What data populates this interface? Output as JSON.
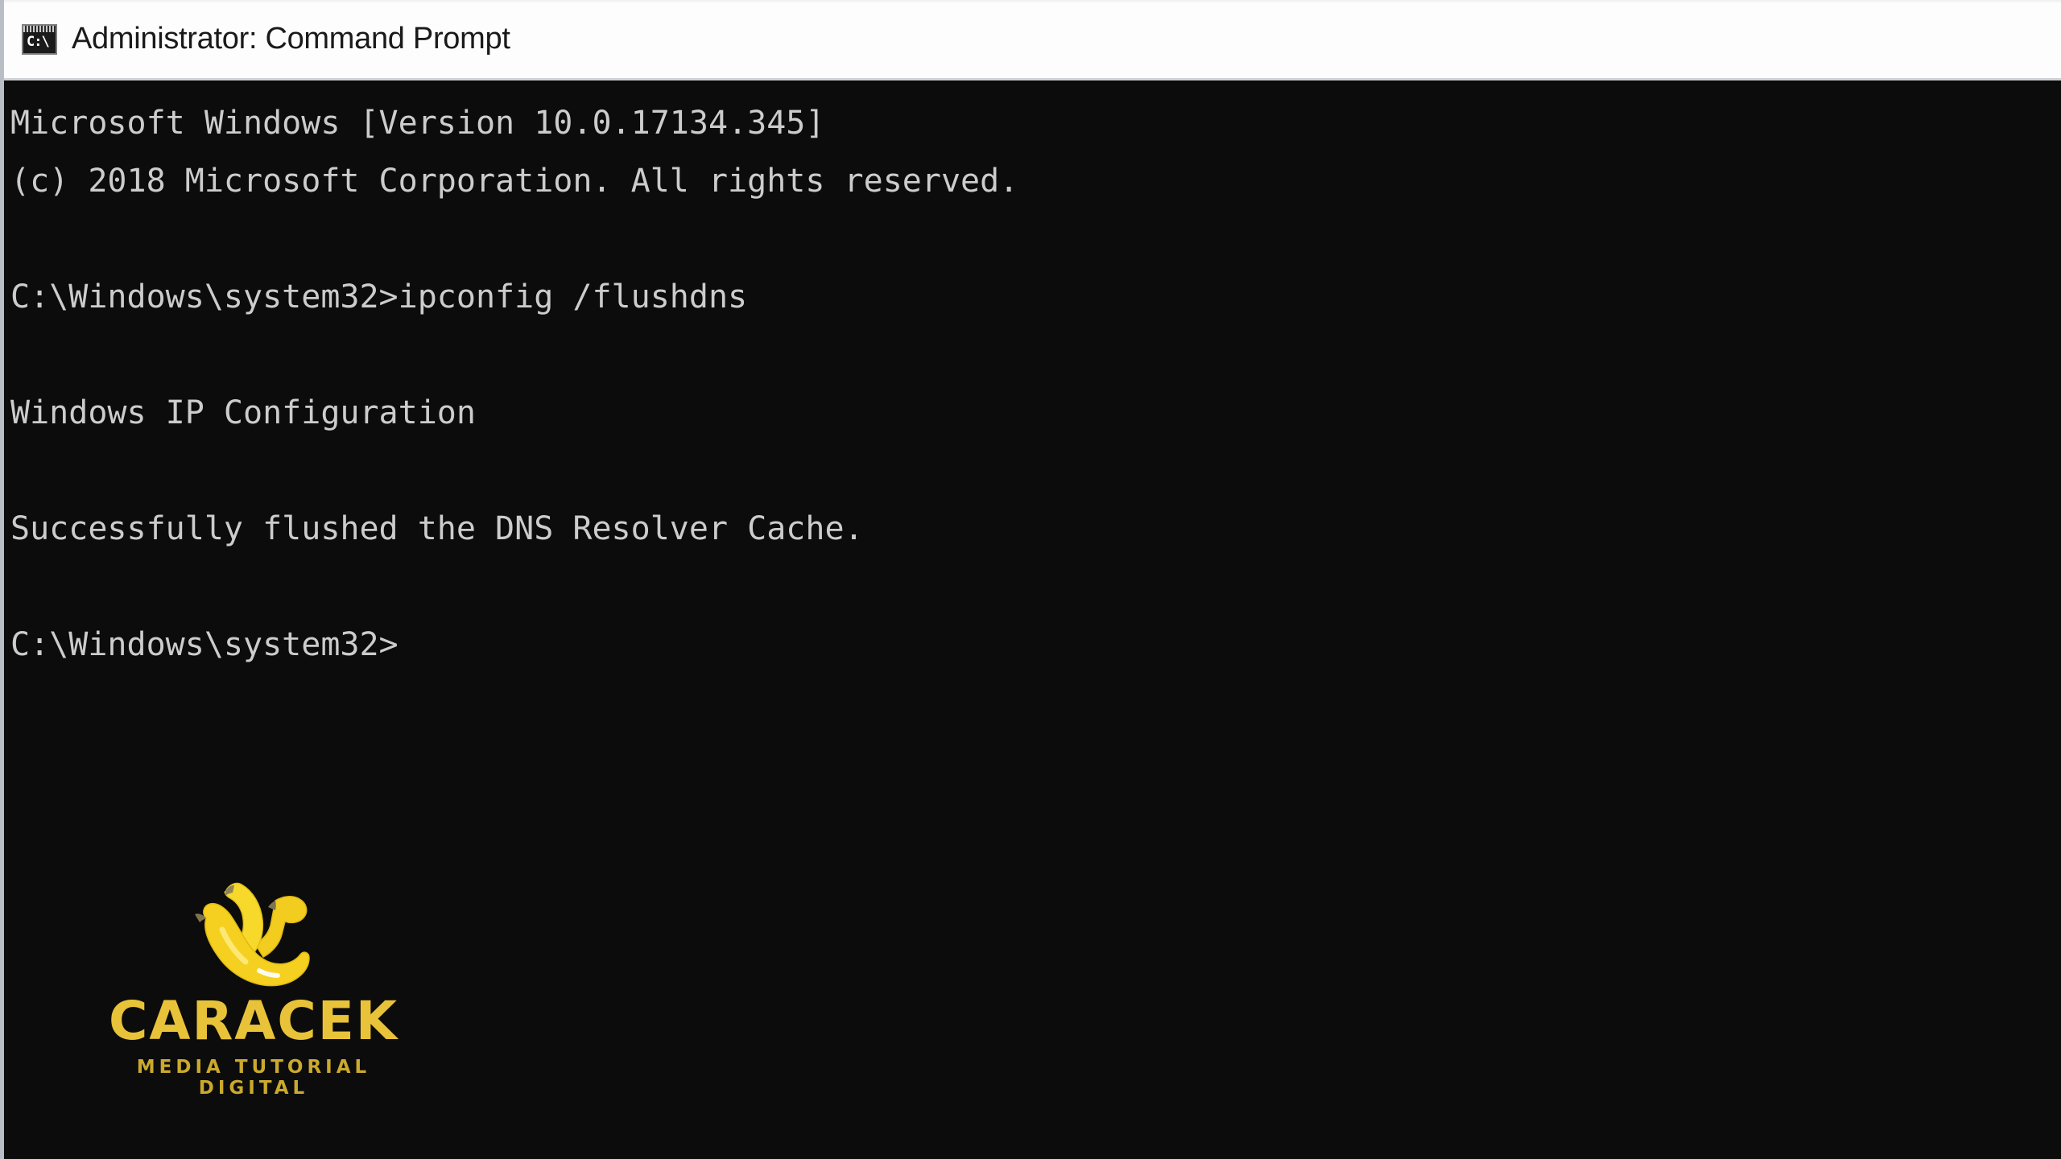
{
  "window": {
    "title": "Administrator: Command Prompt",
    "icon": "cmd-icon",
    "icon_glyph": "C:\\",
    "titlebar_color": "#fdfdfd",
    "console_background": "#0c0c0c",
    "console_foreground": "#cccccc"
  },
  "console": {
    "lines": [
      {
        "text": "Microsoft Windows [Version 10.0.17134.345]",
        "blank": false
      },
      {
        "text": "(c) 2018 Microsoft Corporation. All rights reserved.",
        "blank": false
      },
      {
        "text": "",
        "blank": true
      },
      {
        "text": "C:\\Windows\\system32>ipconfig /flushdns",
        "blank": false
      },
      {
        "text": "",
        "blank": true
      },
      {
        "text": "Windows IP Configuration",
        "blank": false
      },
      {
        "text": "",
        "blank": true
      },
      {
        "text": "Successfully flushed the DNS Resolver Cache.",
        "blank": false
      },
      {
        "text": "",
        "blank": true
      },
      {
        "text": "C:\\Windows\\system32>",
        "blank": false
      }
    ],
    "prompt": "C:\\Windows\\system32>",
    "command": "ipconfig /flushdns",
    "result": "Successfully flushed the DNS Resolver Cache."
  },
  "watermark": {
    "logo_icon": "banana-bunch-icon",
    "brand": "CARACEK",
    "tagline": "MEDIA TUTORIAL DIGITAL",
    "brand_color": "#e8c33a",
    "banana_color": "#f5d021"
  }
}
